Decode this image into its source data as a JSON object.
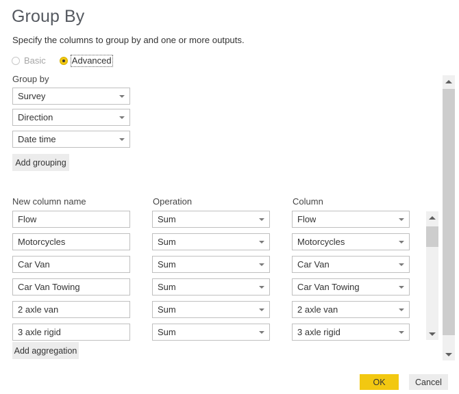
{
  "dialog": {
    "title": "Group By",
    "subtitle": "Specify the columns to group by and one or more outputs."
  },
  "mode": {
    "basic_label": "Basic",
    "advanced_label": "Advanced",
    "selected": "Advanced"
  },
  "group_by": {
    "label": "Group by",
    "rows": [
      {
        "column": "Survey"
      },
      {
        "column": "Direction"
      },
      {
        "column": "Date time"
      }
    ],
    "add_button": "Add grouping"
  },
  "aggregations": {
    "headers": {
      "new_column_name": "New column name",
      "operation": "Operation",
      "column": "Column"
    },
    "rows": [
      {
        "new_column_name": "Flow",
        "operation": "Sum",
        "column": "Flow"
      },
      {
        "new_column_name": "Motorcycles",
        "operation": "Sum",
        "column": "Motorcycles"
      },
      {
        "new_column_name": "Car Van",
        "operation": "Sum",
        "column": "Car Van"
      },
      {
        "new_column_name": "Car Van Towing",
        "operation": "Sum",
        "column": "Car Van Towing"
      },
      {
        "new_column_name": "2 axle van",
        "operation": "Sum",
        "column": "2 axle van"
      },
      {
        "new_column_name": "3 axle rigid",
        "operation": "Sum",
        "column": "3 axle rigid"
      }
    ],
    "add_button": "Add aggregation"
  },
  "footer": {
    "ok_label": "OK",
    "cancel_label": "Cancel"
  },
  "icons": {
    "caret_down": "chevron-down-icon",
    "scroll_up": "scroll-up-arrow-icon",
    "scroll_down": "scroll-down-arrow-icon"
  },
  "colors": {
    "accent": "#f2c811",
    "button_face": "#ececec",
    "border": "#bfbfbf",
    "text": "#333333",
    "muted_text": "#a6a6a6",
    "scrollbar_track": "#f0f0f0",
    "scrollbar_thumb": "#cdcdcd"
  }
}
